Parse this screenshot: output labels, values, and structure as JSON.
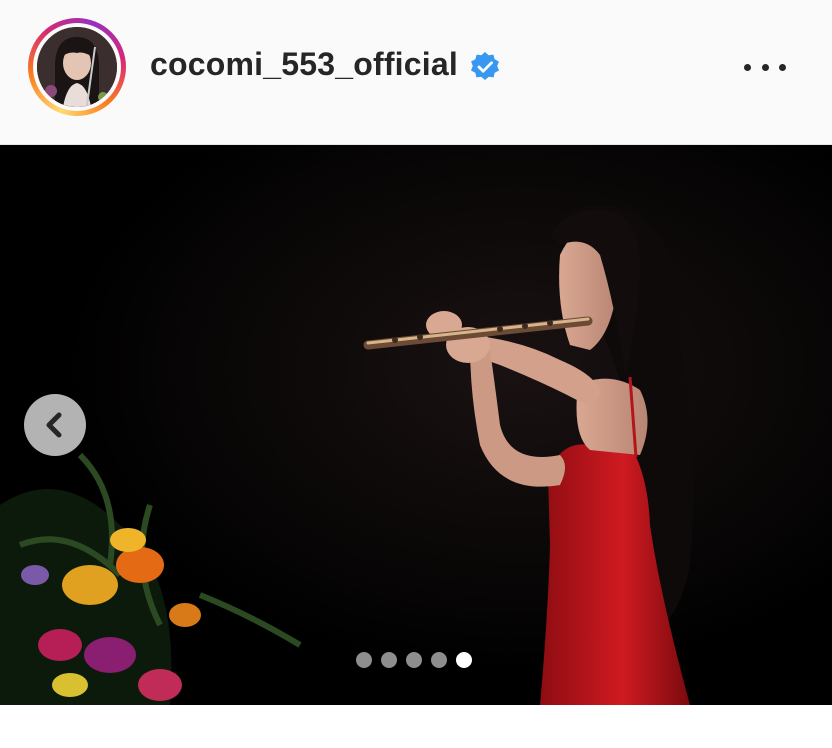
{
  "post": {
    "username": "cocomi_553_official",
    "verified": true,
    "avatar_icon": "profile-avatar",
    "more_icon": "more-options-icon",
    "carousel": {
      "prev_icon": "chevron-left-icon",
      "total_slides": 5,
      "active_slide": 5
    },
    "colors": {
      "text": "#262626",
      "verified_badge": "#3897f0",
      "dress": "#c0141a",
      "background": "#000000"
    }
  }
}
